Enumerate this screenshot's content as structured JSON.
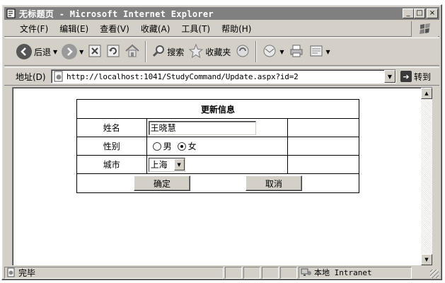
{
  "window": {
    "title": "无标题页 - Microsoft Internet Explorer",
    "minimize": "_",
    "maximize": "□",
    "close": "×"
  },
  "menu": {
    "items": [
      "文件(F)",
      "编辑(E)",
      "查看(V)",
      "收藏(A)",
      "工具(T)",
      "帮助(H)"
    ]
  },
  "toolbar": {
    "back_label": "后退",
    "search_label": "搜索",
    "favorites_label": "收藏夹"
  },
  "address": {
    "label": "地址(D)",
    "url": "http://localhost:1041/StudyCommand/Update.aspx?id=2",
    "go_label": "转到"
  },
  "form": {
    "header": "更新信息",
    "name_label": "姓名",
    "name_value": "王晓慧",
    "gender_label": "性别",
    "gender_options": [
      "男",
      "女"
    ],
    "gender_selected": "女",
    "city_label": "城市",
    "city_value": "上海",
    "confirm_label": "确定",
    "cancel_label": "取消"
  },
  "status": {
    "text": "完毕",
    "zone": "本地 Intranet"
  },
  "colors": {
    "titlebar_inactive": "#808080",
    "chrome": "#d4d0c8"
  }
}
